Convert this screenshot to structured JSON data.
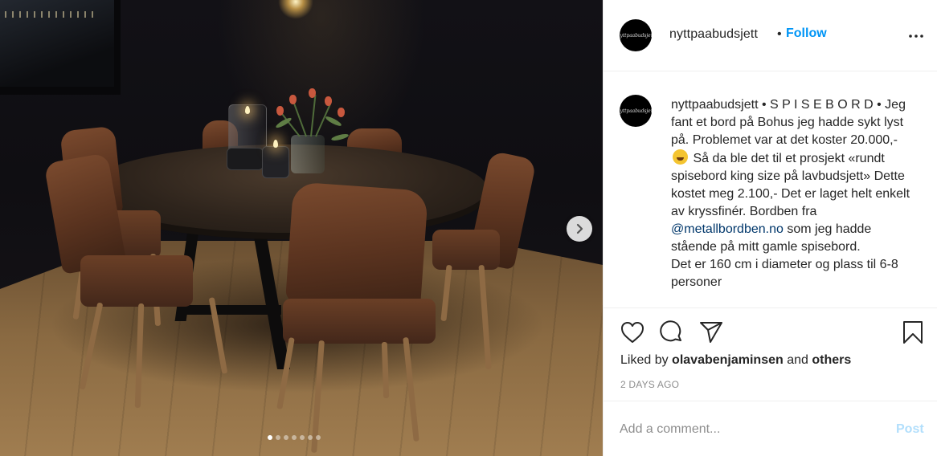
{
  "header": {
    "avatar_text": "nyttpaabudsjett",
    "username": "nyttpaabudsjett",
    "separator": "•",
    "follow_label": "Follow"
  },
  "caption": {
    "avatar_text": "nyttpaabudsjett",
    "username": "nyttpaabudsjett",
    "title": "• S P I S E B O R D •",
    "line_1": "Jeg fant et bord på Bohus jeg hadde sykt lyst på. Problemet var at det koster 20.000,-",
    "line_2": "Så da ble det til et prosjekt «rundt spisebord king size på lavbudsjett» Dette kostet meg 2.100,- Det er laget helt enkelt av kryssfinér. Bordben fra",
    "mention": "@metallbordben.no",
    "line_3": "som jeg hadde stående på mitt gamle spisebord.",
    "line_4": "Det er 160 cm i diameter og plass til 6-8 personer"
  },
  "icons": {
    "like": "heart-icon",
    "comment": "comment-icon",
    "share": "share-icon",
    "save": "bookmark-icon",
    "more": "more-icon",
    "next": "chevron-right-icon"
  },
  "likes": {
    "prefix": "Liked by",
    "user": "olavabenjaminsen",
    "conjunction": "and",
    "others": "others"
  },
  "timestamp": "2 DAYS AGO",
  "comment": {
    "placeholder": "Add a comment...",
    "post_label": "Post"
  },
  "carousel": {
    "total": 7,
    "active_index": 0
  },
  "colors": {
    "link_blue": "#0095f6",
    "mention_blue": "#00376b",
    "post_disabled": "#b2dffc",
    "muted": "#8e8e8e"
  }
}
